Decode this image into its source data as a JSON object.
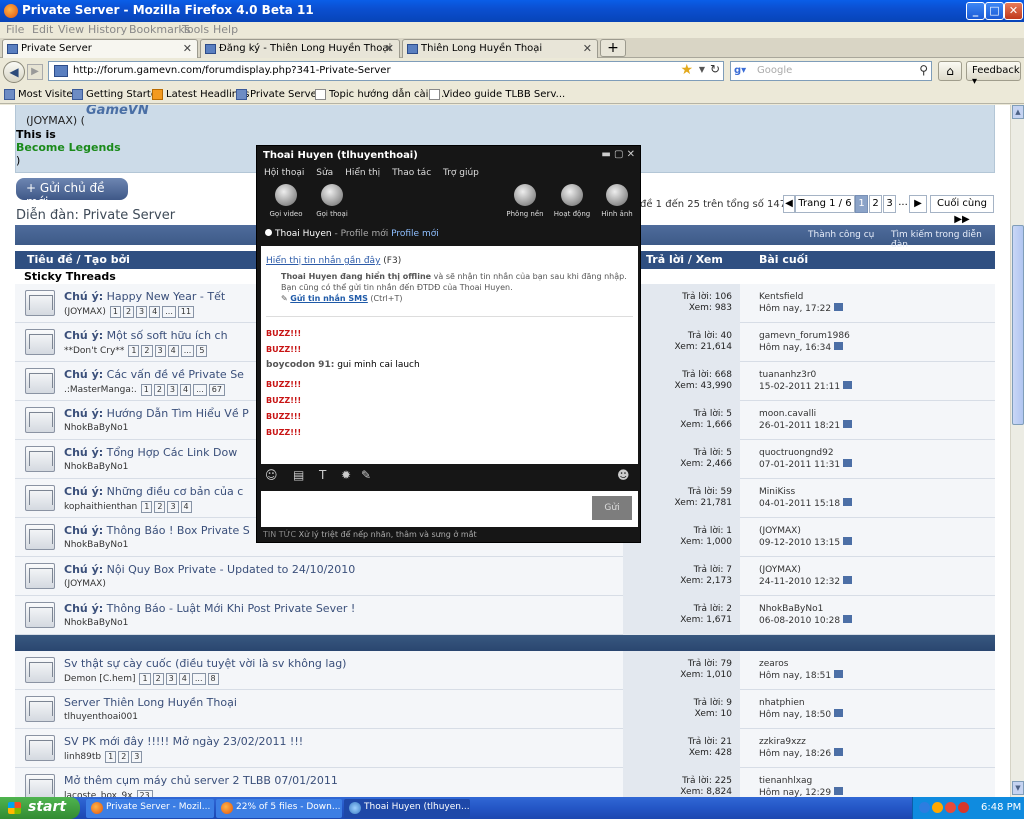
{
  "window": {
    "title": "Private Server - Mozilla Firefox 4.0 Beta 11"
  },
  "menu": [
    "File",
    "Edit",
    "View",
    "History",
    "Bookmarks",
    "Tools",
    "Help"
  ],
  "tabs": [
    {
      "label": "Private Server",
      "active": true
    },
    {
      "label": "Đăng ký - Thiên Long Huyền Thoại",
      "active": false
    },
    {
      "label": "Thiên Long Huyền Thoại",
      "active": false
    }
  ],
  "nav": {
    "url": "http://forum.gamevn.com/forumdisplay.php?341-Private-Server",
    "search_placeholder": "Google",
    "feedback_label": "Feedback"
  },
  "bookmarks": [
    "Most Visited",
    "Getting Started",
    "Latest Headlines",
    "Private Server",
    "Topic hướng dẫn cài đ...",
    "Video guide TLBB Serv..."
  ],
  "header": {
    "line1": "(JOYMAX) (",
    "logo": "GameVN",
    "line2": "This is",
    "line3": "Become Legends",
    "line4": ")"
  },
  "forum": {
    "new_thread": "+ Gửi chủ đề mới",
    "title": "Diễn đàn: Private Server",
    "pager_info": "đề 1 đến 25 trên tổng số 147",
    "pager": [
      "◀",
      "Trang 1 / 6",
      "1",
      "2",
      "3",
      "...",
      "▶",
      "Cuối cùng ▶▶"
    ],
    "bar_links": [
      "Thành công cụ",
      "Tìm kiếm trong diễn đàn"
    ],
    "col_title": "Tiêu đề / Tạo bởi",
    "col_replies": "Trả lời / Xem",
    "col_last": "Bài cuối",
    "sticky_label": "Sticky Threads"
  },
  "threads": [
    {
      "prefix": "Chú ý:",
      "title": "Happy New Year - Tết",
      "by": "(JOYMAX)",
      "pages": [
        "1",
        "2",
        "3",
        "4",
        "...",
        "11"
      ],
      "replies": "Trả lời: 106",
      "views": "Xem: 983",
      "last_user": "Kentsfield",
      "last_time": "Hôm nay, 17:22"
    },
    {
      "prefix": "Chú ý:",
      "title": "Một số soft hữu ích ch",
      "by": "**Don't Cry**",
      "pages": [
        "1",
        "2",
        "3",
        "4",
        "...",
        "5"
      ],
      "replies": "Trả lời: 40",
      "views": "Xem: 21,614",
      "last_user": "gamevn_forum1986",
      "last_time": "Hôm nay, 16:34"
    },
    {
      "prefix": "Chú ý:",
      "title": "Các vấn đề về Private Se",
      "by": ".:MasterManga:.",
      "pages": [
        "1",
        "2",
        "3",
        "4",
        "...",
        "67"
      ],
      "replies": "Trả lời: 668",
      "views": "Xem: 43,990",
      "last_user": "tuananhz3r0",
      "last_time": "15-02-2011 21:11"
    },
    {
      "prefix": "Chú ý:",
      "title": "Hướng Dẫn Tìm Hiểu Về P",
      "by": "NhokBaByNo1",
      "pages": [],
      "replies": "Trả lời: 5",
      "views": "Xem: 1,666",
      "last_user": "moon.cavalli",
      "last_time": "26-01-2011 18:21"
    },
    {
      "prefix": "Chú ý:",
      "title": "Tổng Hợp Các Link Dow",
      "by": "NhokBaByNo1",
      "pages": [],
      "replies": "Trả lời: 5",
      "views": "Xem: 2,466",
      "last_user": "quoctruongnd92",
      "last_time": "07-01-2011 11:31"
    },
    {
      "prefix": "Chú ý:",
      "title": "Những điều cơ bản của c",
      "by": "kophaithienthan",
      "pages": [
        "1",
        "2",
        "3",
        "4"
      ],
      "replies": "Trả lời: 59",
      "views": "Xem: 21,781",
      "last_user": "MiniKiss",
      "last_time": "04-01-2011 15:18"
    },
    {
      "prefix": "Chú ý:",
      "title": "Thông Báo ! Box Private S",
      "by": "NhokBaByNo1",
      "pages": [],
      "replies": "Trả lời: 1",
      "views": "Xem: 1,000",
      "last_user": "(JOYMAX)",
      "last_time": "09-12-2010 13:15"
    },
    {
      "prefix": "Chú ý:",
      "title": "Nội Quy Box Private - Updated to 24/10/2010",
      "by": "(JOYMAX)",
      "pages": [],
      "replies": "Trả lời: 7",
      "views": "Xem: 2,173",
      "last_user": "(JOYMAX)",
      "last_time": "24-11-2010 12:32"
    },
    {
      "prefix": "Chú ý:",
      "title": "Thông Báo - Luật Mới Khi Post Private Sever !",
      "by": "NhokBaByNo1",
      "pages": [],
      "replies": "Trả lời: 2",
      "views": "Xem: 1,671",
      "last_user": "NhokBaByNo1",
      "last_time": "06-08-2010 10:28"
    }
  ],
  "normal_threads": [
    {
      "prefix": "",
      "title": "Sv thật sự cày cuốc (điều tuyệt vời là sv không lag)",
      "by": "Demon [C.hem]",
      "pages": [
        "1",
        "2",
        "3",
        "4",
        "...",
        "8"
      ],
      "replies": "Trả lời: 79",
      "views": "Xem: 1,010",
      "last_user": "zearos",
      "last_time": "Hôm nay, 18:51"
    },
    {
      "prefix": "",
      "title": "Server Thiên Long Huyền Thoại",
      "by": "tlhuyenthoai001",
      "pages": [],
      "replies": "Trả lời: 9",
      "views": "Xem: 10",
      "last_user": "nhatphien",
      "last_time": "Hôm nay, 18:50"
    },
    {
      "prefix": "",
      "title": "SV PK mới đây !!!!! Mở ngày 23/02/2011 !!!",
      "by": "linh89tb",
      "pages": [
        "1",
        "2",
        "3"
      ],
      "replies": "Trả lời: 21",
      "views": "Xem: 428",
      "last_user": "zzkira9xzz",
      "last_time": "Hôm nay, 18:26"
    },
    {
      "prefix": "",
      "title": "Mở thêm cụm máy chủ server 2 TLBB 07/01/2011",
      "by": "lacoste_box_9x",
      "pages": [
        "23"
      ],
      "replies": "Trả lời: 225",
      "views": "Xem: 8,824",
      "last_user": "tienanhlxag",
      "last_time": "Hôm nay, 12:29"
    }
  ],
  "chat": {
    "title": "Thoai Huyen (tlhuyenthoai)",
    "menu": [
      "Hội thoại",
      "Sửa",
      "Hiển thị",
      "Thao tác",
      "Trợ giúp"
    ],
    "tools_left": [
      "Gọi video",
      "Gọi thoại"
    ],
    "tools_right": [
      "Phông nền",
      "Hoạt động",
      "Hình ảnh"
    ],
    "status_name": "Thoai Huyen",
    "status_profile": " - Profile mới",
    "status_profile_link": "Profile mới",
    "recent_link": "Hiển thị tin nhắn gần đây",
    "recent_key": "(F3)",
    "offline_bold": "Thoai Huyen đang hiển thị offline",
    "offline_text": " và sẽ nhận tin nhắn của bạn sau khi đăng nhập. Bạn cũng có thể gửi tin nhắn đến ĐTDĐ của Thoai Huyen.",
    "sms_link": "Gửi tin nhắn SMS",
    "sms_key": "(Ctrl+T)",
    "buzz": "BUZZ!!!",
    "msg_user": "boycodon 91:",
    "msg_text": "gui minh cai lauch",
    "send": "Gửi",
    "news_label": "TIN TỨC",
    "news_text": "Xử lý triệt để nếp nhăn, thâm và sưng ở mắt"
  },
  "taskbar": {
    "start": "start",
    "tasks": [
      "Private Server - Mozil...",
      "22% of 5 files - Down...",
      "Thoai Huyen (tlhuyen..."
    ],
    "clock": "6:48 PM"
  }
}
